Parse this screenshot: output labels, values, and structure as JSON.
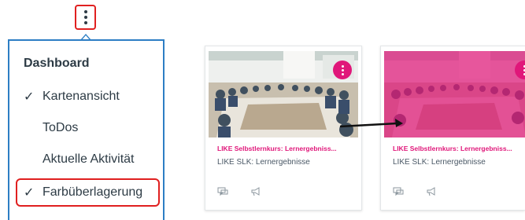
{
  "menu": {
    "title": "Dashboard",
    "items": [
      {
        "label": "Kartenansicht",
        "checked": true
      },
      {
        "label": "ToDos",
        "checked": false
      },
      {
        "label": "Aktuelle Aktivität",
        "checked": false
      },
      {
        "label": "Farbüberlagerung",
        "checked": true
      }
    ]
  },
  "cards": [
    {
      "title": "LIKE Selbstlernkurs: Lernergebniss...",
      "subtitle": "LIKE SLK: Lernergebnisse",
      "overlay": false,
      "accent_color": "#e0177a"
    },
    {
      "title": "LIKE Selbstlernkurs: Lernergebniss...",
      "subtitle": "LIKE SLK: Lernergebnisse",
      "overlay": true,
      "accent_color": "#e0177a"
    }
  ],
  "icons": {
    "kebab": "kebab-menu-icon",
    "check": "checkmark-icon",
    "discussions": "discussions-icon",
    "announcements": "announcements-icon"
  },
  "colors": {
    "accent": "#e0177a",
    "highlight": "#e02020",
    "menu_border": "#2d7ec4"
  }
}
